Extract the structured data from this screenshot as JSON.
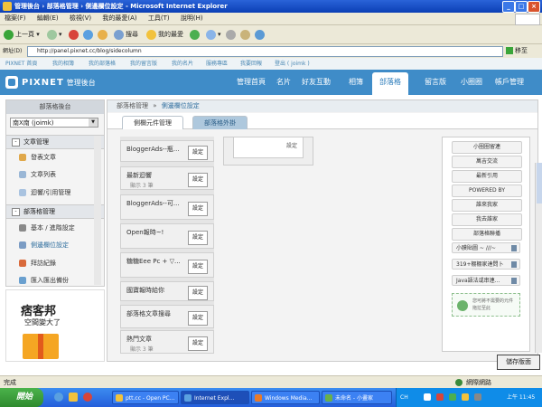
{
  "window": {
    "title": "管理後台 › 部落格管理 › 側邊欄位設定 - Microsoft Internet Explorer"
  },
  "menubar": [
    "檔案(F)",
    "編輯(E)",
    "檢視(V)",
    "我的最愛(A)",
    "工具(T)",
    "說明(H)"
  ],
  "toolbar": {
    "back": "上一頁",
    "search": "搜尋",
    "favorites": "我的最愛"
  },
  "address": {
    "label": "網址(D)",
    "url": "http://panel.pixnet.cc/blog/sidecolumn",
    "go": "移至"
  },
  "sitenav": [
    "PIXNET 首頁",
    "我的相簿",
    "我的部落格",
    "我的留言版",
    "我的名片",
    "服務專區",
    "我要回報",
    "登出 ( joimk )"
  ],
  "header": {
    "logo": "PIXNET",
    "logo_sub": "管理後台",
    "tabs": [
      "管理首頁",
      "名片",
      "好友互動",
      "相簿",
      "部落格",
      "留言版",
      "小圈圈",
      "帳戶管理"
    ]
  },
  "sidebar": {
    "title": "部落格後台",
    "blog_select": "南X南 (joimk)",
    "sections": [
      {
        "label": "文章管理",
        "items": [
          "發表文章",
          "文章列表",
          "迴響/引用管理"
        ]
      },
      {
        "label": "部落格管理",
        "items": [
          "基本 / 進階設定",
          "側邊欄位設定",
          "拜訪紀錄",
          "匯入匯出備份"
        ]
      }
    ]
  },
  "ad": {
    "line1": "痞客邦",
    "line2": "空間變大了"
  },
  "main": {
    "breadcrumb_root": "部落格管理",
    "breadcrumb_current": "側邊欄位設定",
    "tabs": [
      "側欄元件管理",
      "部落格外掛"
    ],
    "widgets": [
      {
        "name": "BloggerAds--瓶...",
        "sub": "",
        "btn": "設定"
      },
      {
        "name": "最新迴響",
        "sub": "顯示 3 筆",
        "btn": "設定"
      },
      {
        "name": "BloggerAds--可...",
        "sub": "",
        "btn": "設定"
      },
      {
        "name": "Open報時~!",
        "sub": "",
        "btn": "設定"
      },
      {
        "name": "糖糖Eee Pc + ▽...",
        "sub": "",
        "btn": "設定"
      },
      {
        "name": "國寶報時給你",
        "sub": "",
        "btn": "設定"
      },
      {
        "name": "部落格文章搜尋",
        "sub": "",
        "btn": "設定"
      },
      {
        "name": "熱門文章",
        "sub": "顯示 3 筆",
        "btn": "設定"
      }
    ],
    "col2_button": "設定",
    "right_items": [
      "小圈圈留連",
      "萬吉交流",
      "最新引用",
      "POWERED BY",
      "誰來我家",
      "我去誰家",
      "部落格聯播"
    ],
    "right_removable": [
      "小膜貼圖 ~ ///~",
      "319+棚棚家達問卜",
      "Java語法或串連..."
    ],
    "dropzone": "您可將不需要的元件拖拉至此",
    "save": "儲存版面"
  },
  "status": {
    "left": "完成",
    "right": "網際網路"
  },
  "taskbar": {
    "start": "開始",
    "tasks": [
      "ptt.cc - Open PC...",
      "Internet Expl...",
      "Windows Media...",
      "未命名 - 小畫家"
    ],
    "lang": "CH",
    "clock": "上午 11:45"
  }
}
